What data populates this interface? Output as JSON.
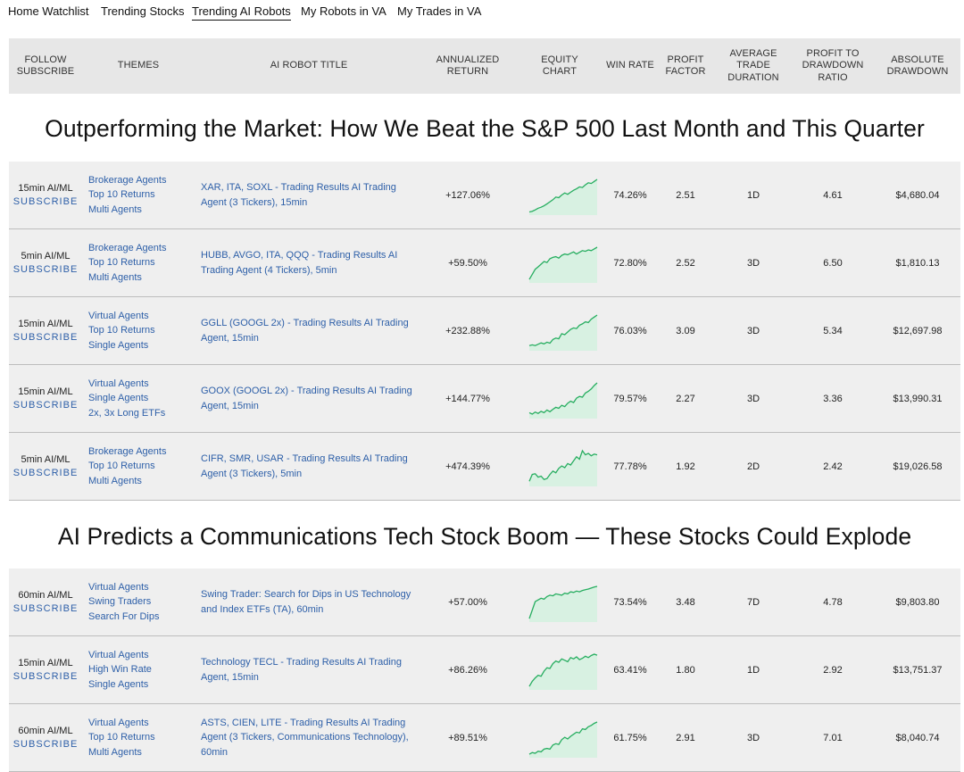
{
  "nav": [
    {
      "label": "Home Watchlist",
      "active": false
    },
    {
      "label": "Trending Stocks",
      "active": false
    },
    {
      "label": "Trending AI Robots",
      "active": true
    },
    {
      "label": "My Robots in VA",
      "active": false
    },
    {
      "label": "My Trades in VA",
      "active": false
    }
  ],
  "table_header": {
    "follow": "FOLLOW SUBSCRIBE",
    "themes": "THEMES",
    "title": "AI ROBOT TITLE",
    "annualized": "ANNUALIZED RETURN",
    "equity": "EQUITY CHART",
    "winrate": "WIN RATE",
    "profit_factor": "PROFIT FACTOR",
    "avg_duration": "AVERAGE TRADE DURATION",
    "ptd_ratio": "PROFIT TO DRAWDOWN RATIO",
    "abs_drawdown": "ABSOLUTE DRAWDOWN"
  },
  "subscribe_label": "SUBSCRIBE",
  "chart_colors": {
    "line": "#27ae60",
    "fill": "#d8f1e2"
  },
  "sections": [
    {
      "title": "Outperforming the Market: How We Beat the S&P 500 Last Month and This Quarter",
      "rows": [
        {
          "frequency": "15min AI/ML",
          "themes": [
            "Brokerage Agents",
            "Top 10 Returns",
            "Multi Agents"
          ],
          "title": "XAR, ITA, SOXL - Trading Results AI Trading Agent (3 Tickers), 15min",
          "annualized_return": "+127.06%",
          "equity": [
            0.04,
            0.06,
            0.1,
            0.15,
            0.18,
            0.22,
            0.28,
            0.34,
            0.4,
            0.48,
            0.46,
            0.54,
            0.6,
            0.56,
            0.62,
            0.68,
            0.72,
            0.78,
            0.76,
            0.84,
            0.9,
            0.88,
            0.94,
            1.0
          ],
          "win_rate": "74.26%",
          "profit_factor": "2.51",
          "avg_duration": "1D",
          "ptd_ratio": "4.61",
          "abs_drawdown": "$4,680.04"
        },
        {
          "frequency": "5min AI/ML",
          "themes": [
            "Brokerage Agents",
            "Top 10 Returns",
            "Multi Agents"
          ],
          "title": "HUBB, AVGO, ITA, QQQ - Trading Results AI Trading Agent (4 Tickers), 5min",
          "annualized_return": "+59.50%",
          "equity": [
            0.05,
            0.2,
            0.35,
            0.42,
            0.5,
            0.58,
            0.55,
            0.66,
            0.7,
            0.72,
            0.68,
            0.76,
            0.8,
            0.78,
            0.82,
            0.86,
            0.8,
            0.85,
            0.9,
            0.88,
            0.92,
            0.9,
            0.95,
            1.0
          ],
          "win_rate": "72.80%",
          "profit_factor": "2.52",
          "avg_duration": "3D",
          "ptd_ratio": "6.50",
          "abs_drawdown": "$1,810.13"
        },
        {
          "frequency": "15min AI/ML",
          "themes": [
            "Virtual Agents",
            "Top 10 Returns",
            "Single Agents"
          ],
          "title": "GGLL (GOOGL 2x) - Trading Results AI Trading Agent, 15min",
          "annualized_return": "+232.88%",
          "equity": [
            0.1,
            0.12,
            0.1,
            0.14,
            0.18,
            0.15,
            0.2,
            0.17,
            0.28,
            0.32,
            0.3,
            0.45,
            0.42,
            0.5,
            0.58,
            0.62,
            0.6,
            0.7,
            0.74,
            0.8,
            0.78,
            0.88,
            0.94,
            1.0
          ],
          "win_rate": "76.03%",
          "profit_factor": "3.09",
          "avg_duration": "3D",
          "ptd_ratio": "5.34",
          "abs_drawdown": "$12,697.98"
        },
        {
          "frequency": "15min AI/ML",
          "themes": [
            "Virtual Agents",
            "Single Agents",
            "2x, 3x Long ETFs"
          ],
          "title": "GOOX (GOOGL 2x) - Trading Results AI Trading Agent, 15min",
          "annualized_return": "+144.77%",
          "equity": [
            0.12,
            0.08,
            0.14,
            0.1,
            0.16,
            0.12,
            0.2,
            0.15,
            0.22,
            0.28,
            0.25,
            0.34,
            0.3,
            0.4,
            0.46,
            0.42,
            0.55,
            0.6,
            0.58,
            0.7,
            0.75,
            0.82,
            0.92,
            1.0
          ],
          "win_rate": "79.57%",
          "profit_factor": "2.27",
          "avg_duration": "3D",
          "ptd_ratio": "3.36",
          "abs_drawdown": "$13,990.31"
        },
        {
          "frequency": "5min AI/ML",
          "themes": [
            "Brokerage Agents",
            "Top 10 Returns",
            "Multi Agents"
          ],
          "title": "CIFR, SMR, USAR - Trading Results AI Trading Agent (3 Tickers), 5min",
          "annualized_return": "+474.39%",
          "equity": [
            0.1,
            0.3,
            0.32,
            0.22,
            0.25,
            0.15,
            0.18,
            0.3,
            0.4,
            0.35,
            0.48,
            0.55,
            0.5,
            0.62,
            0.58,
            0.7,
            0.82,
            0.75,
            1.0,
            0.88,
            0.92,
            0.85,
            0.9,
            0.88
          ],
          "win_rate": "77.78%",
          "profit_factor": "1.92",
          "avg_duration": "2D",
          "ptd_ratio": "2.42",
          "abs_drawdown": "$19,026.58"
        }
      ]
    },
    {
      "title": "AI Predicts a Communications Tech Stock Boom — These Stocks Could Explode",
      "rows": [
        {
          "frequency": "60min AI/ML",
          "themes": [
            "Virtual Agents",
            "Swing Traders",
            "Search For Dips"
          ],
          "title": "Swing Trader: Search for Dips in US Technology and Index ETFs (TA), 60min",
          "annualized_return": "+57.00%",
          "equity": [
            0.05,
            0.3,
            0.55,
            0.6,
            0.65,
            0.62,
            0.7,
            0.74,
            0.72,
            0.78,
            0.76,
            0.74,
            0.8,
            0.78,
            0.84,
            0.82,
            0.86,
            0.84,
            0.88,
            0.9,
            0.92,
            0.95,
            0.98,
            1.0
          ],
          "win_rate": "73.54%",
          "profit_factor": "3.48",
          "avg_duration": "7D",
          "ptd_ratio": "4.78",
          "abs_drawdown": "$9,803.80"
        },
        {
          "frequency": "15min AI/ML",
          "themes": [
            "Virtual Agents",
            "High Win Rate",
            "Single Agents"
          ],
          "title": "Technology TECL - Trading Results AI Trading Agent, 15min",
          "annualized_return": "+86.26%",
          "equity": [
            0.05,
            0.2,
            0.3,
            0.38,
            0.35,
            0.5,
            0.6,
            0.58,
            0.72,
            0.8,
            0.76,
            0.86,
            0.82,
            0.78,
            0.9,
            0.86,
            0.92,
            0.84,
            0.88,
            0.94,
            0.9,
            0.96,
            1.0,
            0.97
          ],
          "win_rate": "63.41%",
          "profit_factor": "1.80",
          "avg_duration": "1D",
          "ptd_ratio": "2.92",
          "abs_drawdown": "$13,751.37"
        },
        {
          "frequency": "60min AI/ML",
          "themes": [
            "Virtual Agents",
            "Top 10 Returns",
            "Multi Agents"
          ],
          "title": "ASTS, CIEN, LITE - Trading Results AI Trading Agent (3 Tickers, Communications Technology), 60min",
          "annualized_return": "+89.51%",
          "equity": [
            0.05,
            0.1,
            0.08,
            0.14,
            0.12,
            0.2,
            0.22,
            0.2,
            0.32,
            0.36,
            0.34,
            0.48,
            0.55,
            0.5,
            0.58,
            0.64,
            0.7,
            0.68,
            0.8,
            0.78,
            0.86,
            0.9,
            0.96,
            1.0
          ],
          "win_rate": "61.75%",
          "profit_factor": "2.91",
          "avg_duration": "3D",
          "ptd_ratio": "7.01",
          "abs_drawdown": "$8,040.74"
        }
      ]
    }
  ]
}
